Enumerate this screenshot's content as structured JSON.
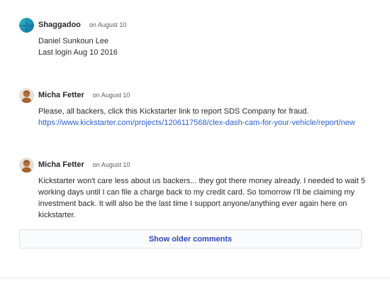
{
  "comments": [
    {
      "author": "Shaggadoo",
      "date": "on August 10",
      "avatar_icon": "teal-globe-avatar",
      "lines": [
        "Daniel Sunkoun Lee",
        "Last login Aug 10 2016"
      ]
    },
    {
      "author": "Micha Fetter",
      "date": "on August 10",
      "avatar_icon": "person-photo-avatar",
      "lines": [
        "Please, all backers, click this Kickstarter link to report SDS Company for fraud."
      ],
      "link": "https://www.kickstarter.com/projects/1206117568/clex-dash-cam-for-your-vehicle/report/new"
    },
    {
      "author": "Micha Fetter",
      "date": "on August 10",
      "avatar_icon": "person-photo-avatar",
      "lines": [
        "Kickstarter won't care less about us backers... they got there money already. I needed to wait 5 working days until I can file a charge back to my credit card. So tomorrow I'll be claiming my investment back. It will also be the last time I support anyone/anything ever again here on kickstarter."
      ]
    }
  ],
  "show_older_label": "Show older comments",
  "colors": {
    "link": "#2a5fd2",
    "button_text": "#2a47b8"
  }
}
